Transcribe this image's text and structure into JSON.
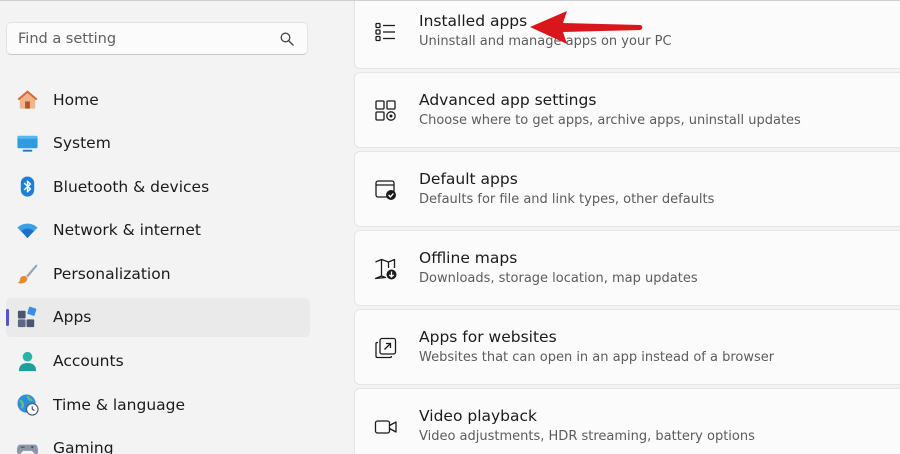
{
  "search": {
    "placeholder": "Find a setting",
    "icon": "search-icon"
  },
  "sidebar": {
    "items": [
      {
        "label": "Home",
        "icon": "home-icon",
        "selected": false
      },
      {
        "label": "System",
        "icon": "monitor-icon",
        "selected": false
      },
      {
        "label": "Bluetooth & devices",
        "icon": "bluetooth-icon",
        "selected": false
      },
      {
        "label": "Network & internet",
        "icon": "wifi-icon",
        "selected": false
      },
      {
        "label": "Personalization",
        "icon": "brush-icon",
        "selected": false
      },
      {
        "label": "Apps",
        "icon": "apps-icon",
        "selected": true
      },
      {
        "label": "Accounts",
        "icon": "person-icon",
        "selected": false
      },
      {
        "label": "Time & language",
        "icon": "globe-clock-icon",
        "selected": false
      },
      {
        "label": "Gaming",
        "icon": "gamepad-icon",
        "selected": false
      }
    ]
  },
  "main": {
    "cards": [
      {
        "title": "Installed apps",
        "desc": "Uninstall and manage apps on your PC",
        "icon": "list-icon"
      },
      {
        "title": "Advanced app settings",
        "desc": "Choose where to get apps, archive apps, uninstall updates",
        "icon": "app-settings-icon"
      },
      {
        "title": "Default apps",
        "desc": "Defaults for file and link types, other defaults",
        "icon": "default-apps-icon"
      },
      {
        "title": "Offline maps",
        "desc": "Downloads, storage location, map updates",
        "icon": "map-download-icon"
      },
      {
        "title": "Apps for websites",
        "desc": "Websites that can open in an app instead of a browser",
        "icon": "open-in-app-icon"
      },
      {
        "title": "Video playback",
        "desc": "Video adjustments, HDR streaming, battery options",
        "icon": "video-icon"
      }
    ]
  },
  "colors": {
    "background": "#f3f3f3",
    "card": "#fbfbfb",
    "accent": "#4f57c9",
    "arrow": "#d8161c"
  }
}
